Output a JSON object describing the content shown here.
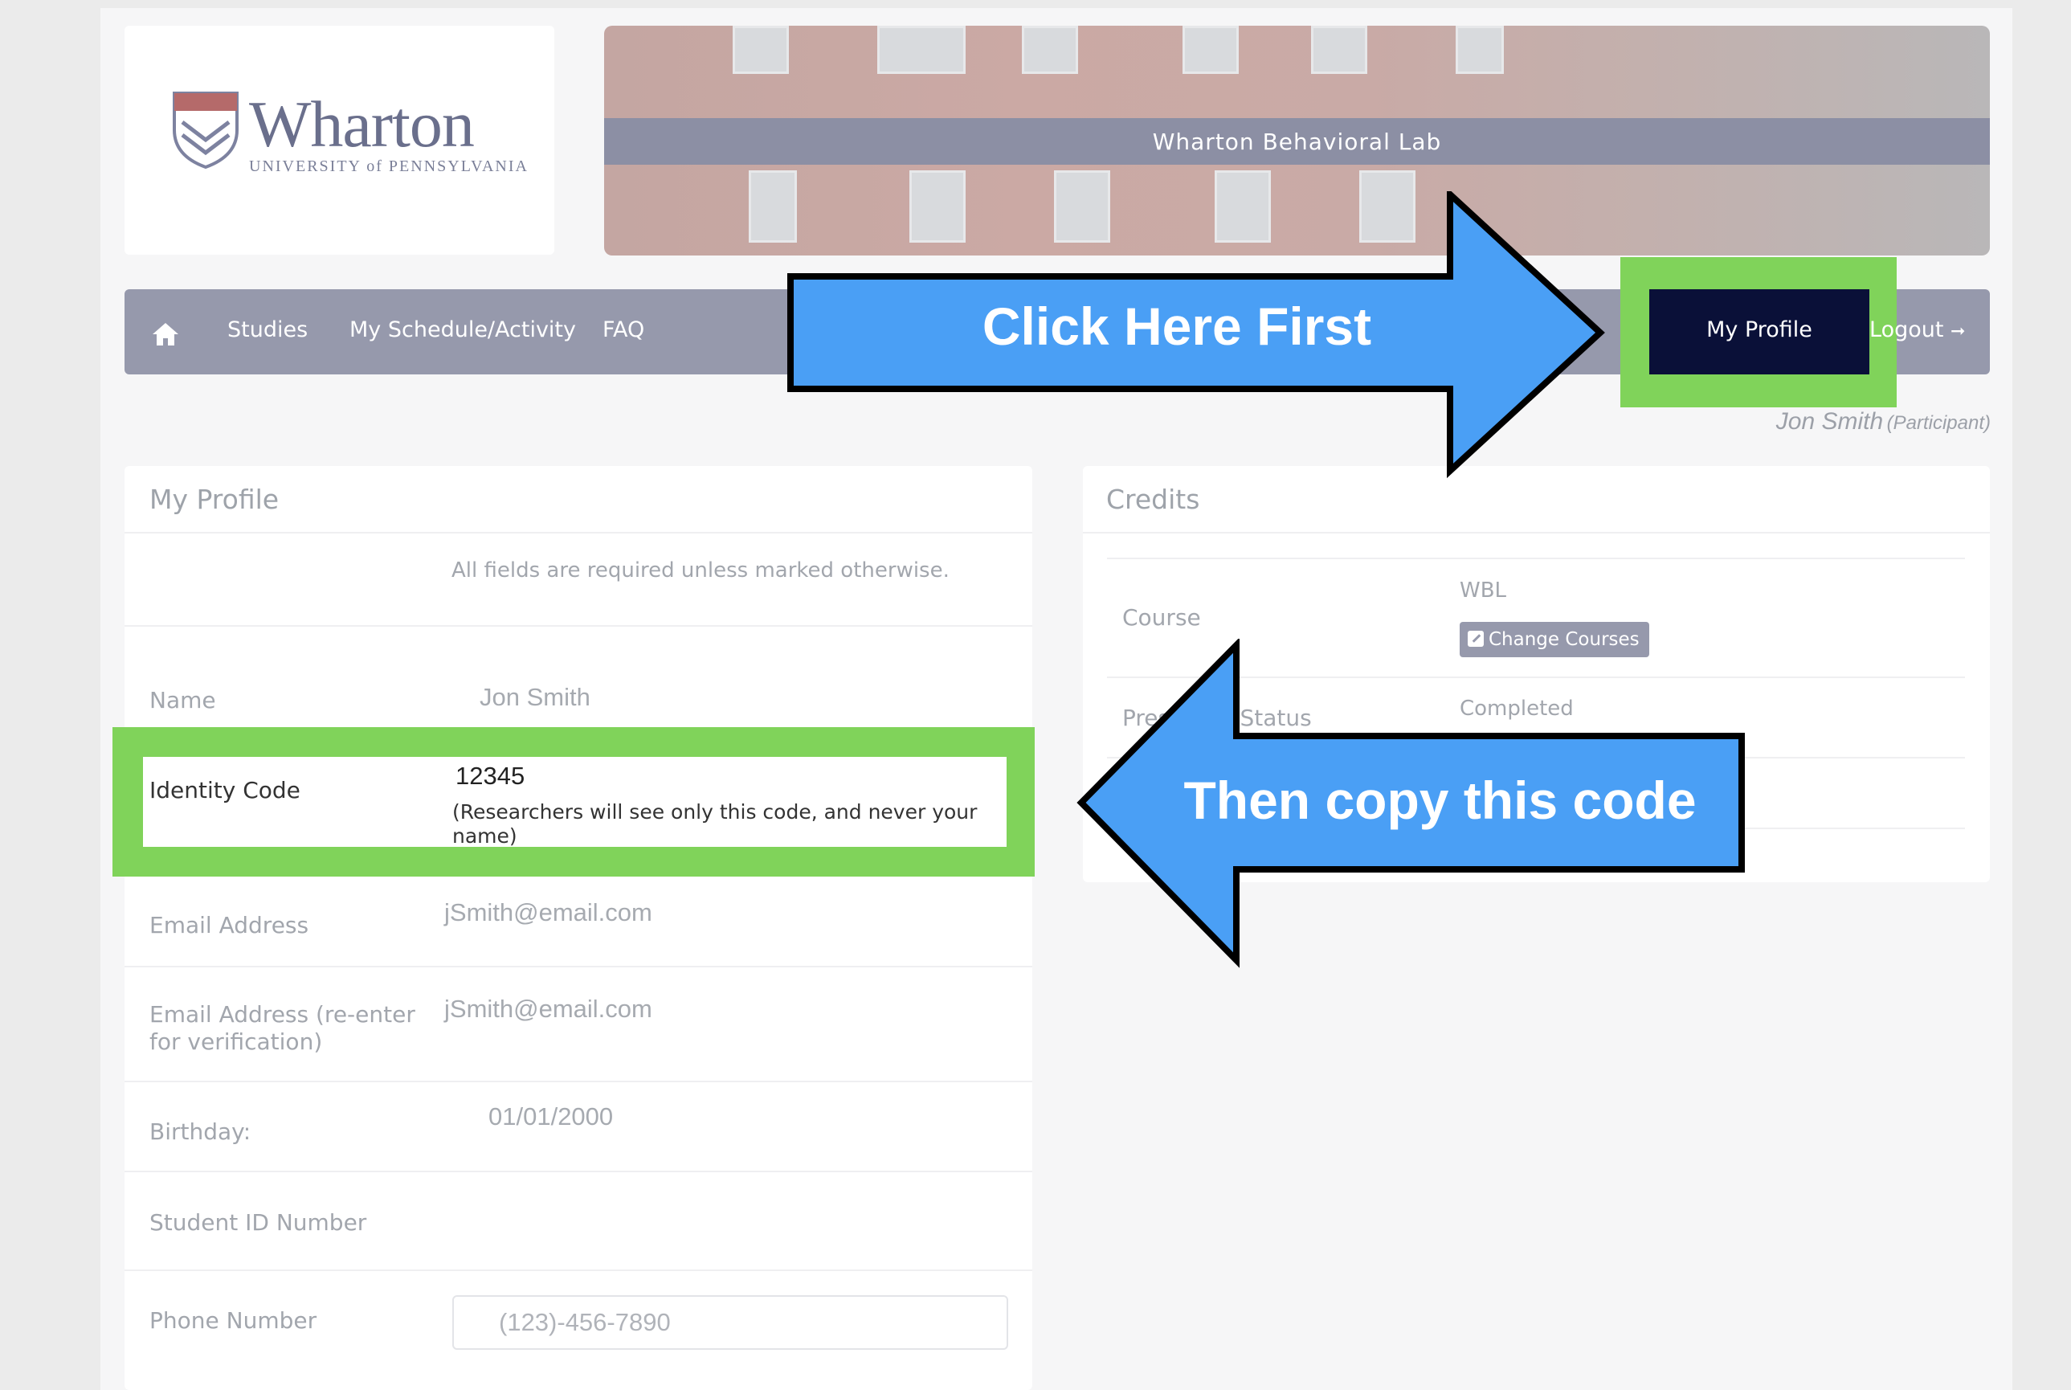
{
  "header": {
    "logo_name": "Wharton",
    "logo_sub": "UNIVERSITY of PENNSYLVANIA",
    "banner_title": "Wharton Behavioral Lab"
  },
  "nav": {
    "home_icon": "home-icon",
    "studies": "Studies",
    "schedule": "My Schedule/Activity",
    "faq": "FAQ",
    "my_profile": "My Profile",
    "logout": "Logout"
  },
  "user": {
    "name": "Jon Smith",
    "role": "(Participant)"
  },
  "profile": {
    "title": "My Profile",
    "required_note": "All fields are required unless marked otherwise.",
    "fields": {
      "name_label": "Name",
      "name_value": "Jon Smith",
      "identity_label": "Identity Code",
      "identity_value": "12345",
      "identity_note_1": "(Researchers will see only this code, and never your",
      "identity_note_2": "name)",
      "email_label": "Email Address",
      "email_value": "jSmith@email.com",
      "email2_label_1": "Email Address (re-enter",
      "email2_label_2": "for verification)",
      "email2_value": "jSmith@email.com",
      "birthday_label": "Birthday:",
      "birthday_value": "01/01/2000",
      "student_id_label": "Student ID Number",
      "phone_label": "Phone Number",
      "phone_placeholder": "(123)-456-7890"
    }
  },
  "credits": {
    "title": "Credits",
    "course_label": "Course",
    "course_value": "WBL",
    "change_courses": "Change Courses",
    "prescreen_label": "Prescreen Status",
    "prescreen_value": "Completed"
  },
  "annotations": {
    "click_first": "Click Here First",
    "copy_code": "Then copy this code",
    "arrow_color": "#4a9ff5",
    "highlight_color": "#80d35a"
  }
}
